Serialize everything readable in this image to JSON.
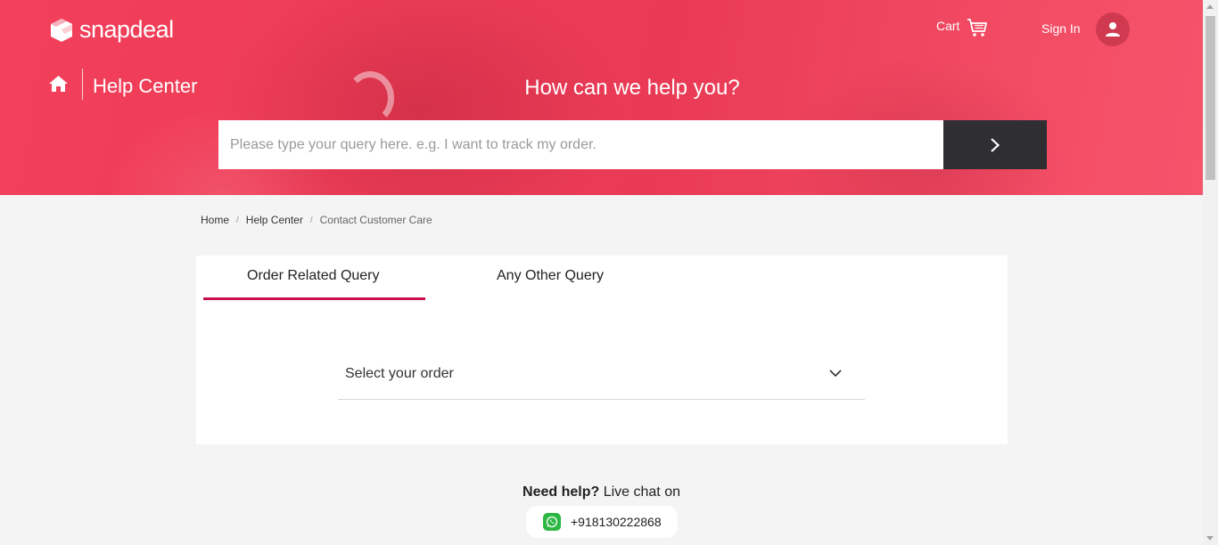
{
  "header": {
    "logo_text": "snapdeal",
    "cart_label": "Cart",
    "signin_label": "Sign In",
    "section_title": "Help Center",
    "heading": "How can we help you?",
    "search_placeholder": "Please type your query here. e.g. I want to track my order.",
    "brand_color": "#ee3d58"
  },
  "breadcrumb": {
    "items": [
      "Home",
      "Help Center",
      "Contact Customer Care"
    ],
    "separator": "/"
  },
  "tabs": [
    {
      "label": "Order Related Query",
      "active": true
    },
    {
      "label": "Any Other Query",
      "active": false
    }
  ],
  "order_select": {
    "label": "Select your order"
  },
  "help": {
    "bold_text": "Need help?",
    "text": "Live chat on",
    "phone": "+918130222868"
  },
  "icons": [
    "snapdeal-logo-icon",
    "cart-icon",
    "user-icon",
    "home-icon",
    "chevron-right-icon",
    "chevron-down-icon",
    "whatsapp-icon"
  ]
}
